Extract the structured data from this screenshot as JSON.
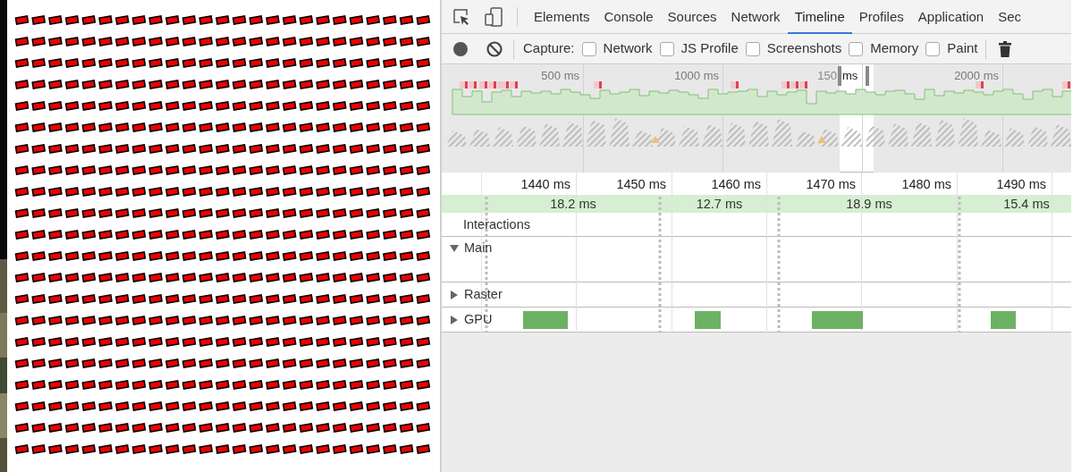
{
  "tabs": [
    {
      "label": "Elements",
      "selected": false
    },
    {
      "label": "Console",
      "selected": false
    },
    {
      "label": "Sources",
      "selected": false
    },
    {
      "label": "Network",
      "selected": false
    },
    {
      "label": "Timeline",
      "selected": true
    },
    {
      "label": "Profiles",
      "selected": false
    },
    {
      "label": "Application",
      "selected": false
    },
    {
      "label": "Sec",
      "selected": false
    }
  ],
  "capture": {
    "label": "Capture:",
    "options": [
      {
        "label": "Network",
        "checked": false
      },
      {
        "label": "JS Profile",
        "checked": false
      },
      {
        "label": "Screenshots",
        "checked": false
      },
      {
        "label": "Memory",
        "checked": false
      },
      {
        "label": "Paint",
        "checked": false
      }
    ]
  },
  "overview": {
    "ticks": [
      "500 ms",
      "1000 ms",
      "150",
      "2000 ms"
    ],
    "selection_label": "ms"
  },
  "ruler": {
    "ticks": [
      "1440 ms",
      "1450 ms",
      "1460 ms",
      "1470 ms",
      "1480 ms",
      "1490 ms"
    ]
  },
  "frames": [
    {
      "duration": "18.2 ms"
    },
    {
      "duration": "12.7 ms"
    },
    {
      "duration": "18.9 ms"
    },
    {
      "duration": "15.4 ms"
    }
  ],
  "tracks": [
    {
      "label": "Interactions",
      "kind": "plain"
    },
    {
      "label": "Main",
      "kind": "group",
      "expanded": true
    },
    {
      "label": "Raster",
      "kind": "group",
      "expanded": false
    },
    {
      "label": "GPU",
      "kind": "group",
      "expanded": false
    }
  ]
}
